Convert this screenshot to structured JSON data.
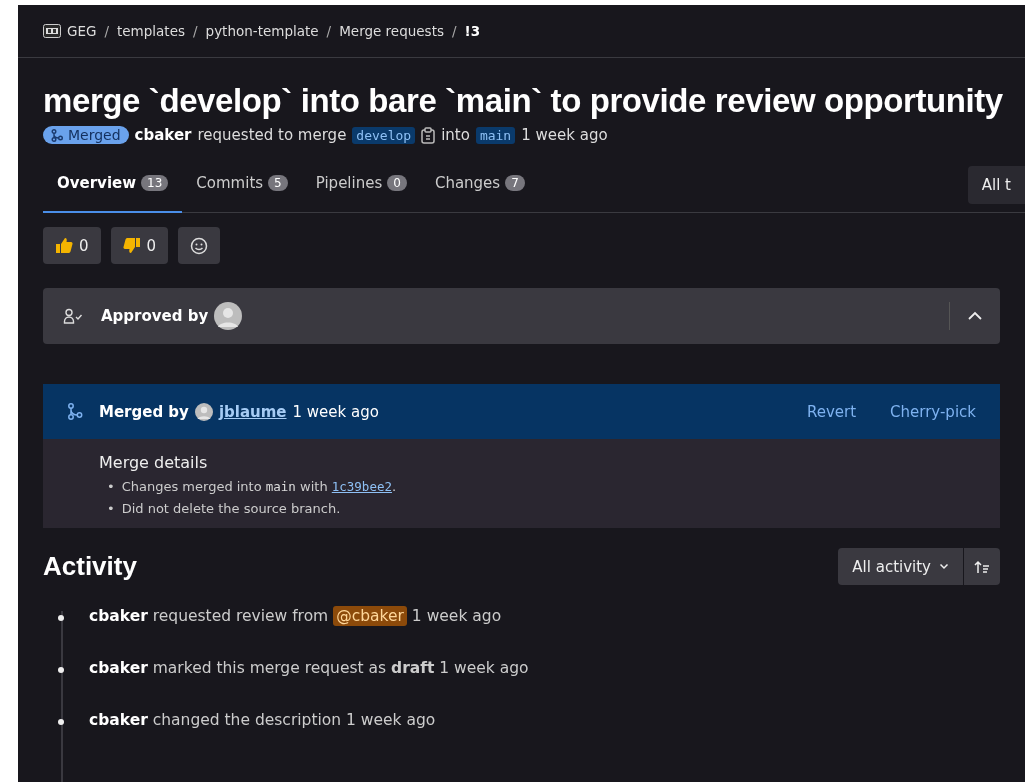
{
  "breadcrumbs": [
    {
      "label": "GEG",
      "kind": "group"
    },
    {
      "label": "templates",
      "kind": "plain"
    },
    {
      "label": "python-template",
      "kind": "plain"
    },
    {
      "label": "Merge requests",
      "kind": "plain"
    },
    {
      "label": "!3",
      "kind": "current"
    }
  ],
  "breadcrumb_separator": "/",
  "title": "merge `develop` into bare `main` to provide review opportunity",
  "status": {
    "badge": "Merged",
    "author": "cbaker",
    "action": "requested to merge",
    "source_branch": "develop",
    "connector": "into",
    "target_branch": "main",
    "time": "1 week ago"
  },
  "tabs": [
    {
      "label": "Overview",
      "count": "13",
      "selected": true
    },
    {
      "label": "Commits",
      "count": "5",
      "selected": false
    },
    {
      "label": "Pipelines",
      "count": "0",
      "selected": false
    },
    {
      "label": "Changes",
      "count": "7",
      "selected": false
    }
  ],
  "tabs_right_button": "All t",
  "reactions": [
    {
      "kind": "thumbs-up",
      "count": "0"
    },
    {
      "kind": "thumbs-down",
      "count": "0"
    },
    {
      "kind": "add"
    }
  ],
  "approvals": {
    "label": "Approved by",
    "expanded": true
  },
  "merged": {
    "label": "Merged by",
    "user": "jblaume",
    "time": "1 week ago",
    "actions": [
      "Revert",
      "Cherry-pick"
    ],
    "details_title": "Merge details",
    "bullet": "•",
    "details": [
      [
        {
          "kind": "text",
          "text": "Changes merged into "
        },
        {
          "kind": "code",
          "text": "main"
        },
        {
          "kind": "text",
          "text": " with "
        },
        {
          "kind": "link",
          "text": "1c39bee2"
        },
        {
          "kind": "text",
          "text": "."
        }
      ],
      [
        {
          "kind": "text",
          "text": "Did not delete the source branch."
        }
      ]
    ]
  },
  "activity": {
    "title": "All activity",
    "heading": "Activity",
    "items": [
      {
        "actor": "cbaker",
        "text": "requested review from",
        "mention": "@cbaker",
        "time": "1 week ago"
      },
      {
        "actor": "cbaker",
        "text": "marked this merge request as **draft**",
        "time": "1 week ago"
      },
      {
        "actor": "cbaker",
        "text": "changed the description",
        "time": "1 week ago"
      }
    ]
  }
}
